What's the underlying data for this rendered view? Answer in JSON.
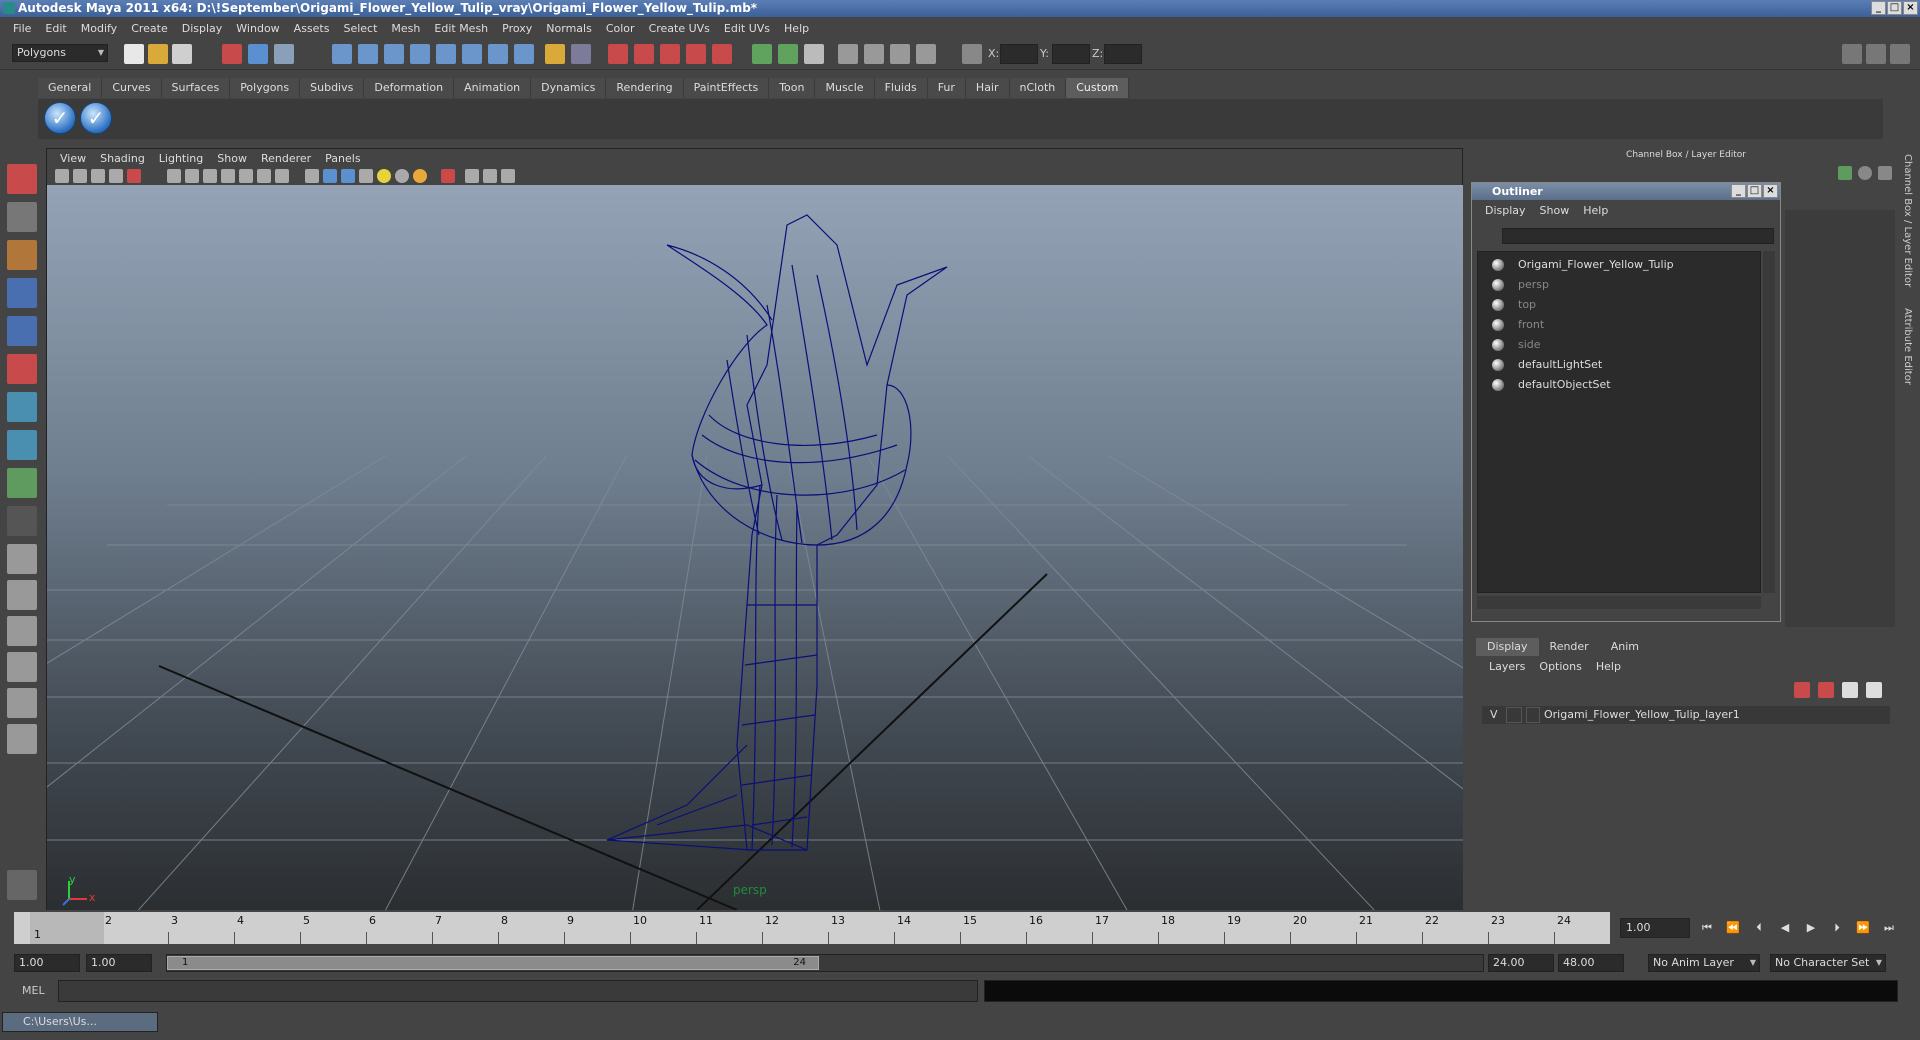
{
  "window": {
    "title": "Autodesk Maya 2011 x64: D:\\!September\\Origami_Flower_Yellow_Tulip_vray\\Origami_Flower_Yellow_Tulip.mb*",
    "controls": [
      "_",
      "□",
      "×"
    ]
  },
  "menubar": [
    "File",
    "Edit",
    "Modify",
    "Create",
    "Display",
    "Window",
    "Assets",
    "Select",
    "Mesh",
    "Edit Mesh",
    "Proxy",
    "Normals",
    "Color",
    "Create UVs",
    "Edit UVs",
    "Help"
  ],
  "statusline": {
    "mode": "Polygons",
    "x_label": "X:",
    "y_label": "Y:",
    "z_label": "Z:"
  },
  "shelf": {
    "tabs": [
      "General",
      "Curves",
      "Surfaces",
      "Polygons",
      "Subdivs",
      "Deformation",
      "Animation",
      "Dynamics",
      "Rendering",
      "PaintEffects",
      "Toon",
      "Muscle",
      "Fluids",
      "Fur",
      "Hair",
      "nCloth",
      "Custom"
    ],
    "active_tab": "Custom",
    "button_glyph": "✓"
  },
  "viewport": {
    "menu": [
      "View",
      "Shading",
      "Lighting",
      "Show",
      "Renderer",
      "Panels"
    ],
    "camera_label": "persp",
    "axis_y": "y",
    "axis_x": "x",
    "wire_color": "#0a0f78"
  },
  "channel_box": {
    "header": "Channel Box / Layer Editor"
  },
  "outliner": {
    "title": "Outliner",
    "menu": [
      "Display",
      "Show",
      "Help"
    ],
    "items": [
      {
        "label": "Origami_Flower_Yellow_Tulip",
        "state": "lit"
      },
      {
        "label": "persp",
        "state": "dim"
      },
      {
        "label": "top",
        "state": "dim"
      },
      {
        "label": "front",
        "state": "dim"
      },
      {
        "label": "side",
        "state": "dim"
      },
      {
        "label": "defaultLightSet",
        "state": "lit"
      },
      {
        "label": "defaultObjectSet",
        "state": "lit"
      }
    ]
  },
  "layer_editor": {
    "tabs": [
      "Display",
      "Render",
      "Anim"
    ],
    "active_tab": "Display",
    "menu": [
      "Layers",
      "Options",
      "Help"
    ],
    "layer": {
      "visible": "V",
      "name": "Origami_Flower_Yellow_Tulip_layer1"
    }
  },
  "side_tabs": [
    "Channel Box / Layer Editor",
    "Attribute Editor"
  ],
  "timeline": {
    "ticks": [
      1,
      2,
      3,
      4,
      5,
      6,
      7,
      8,
      9,
      10,
      11,
      12,
      13,
      14,
      15,
      16,
      17,
      18,
      19,
      20,
      21,
      22,
      23,
      24
    ],
    "current_frame": "1.00",
    "current_marker": "1"
  },
  "range": {
    "start": "1.00",
    "playback_start": "1.00",
    "slider_start": "1",
    "slider_end": "24",
    "playback_end": "24.00",
    "end": "48.00",
    "anim_layer": "No Anim Layer",
    "character_set": "No Character Set"
  },
  "command_line": {
    "label": "MEL"
  },
  "taskbar": {
    "minimized_window": "C:\\Users\\Us..."
  }
}
